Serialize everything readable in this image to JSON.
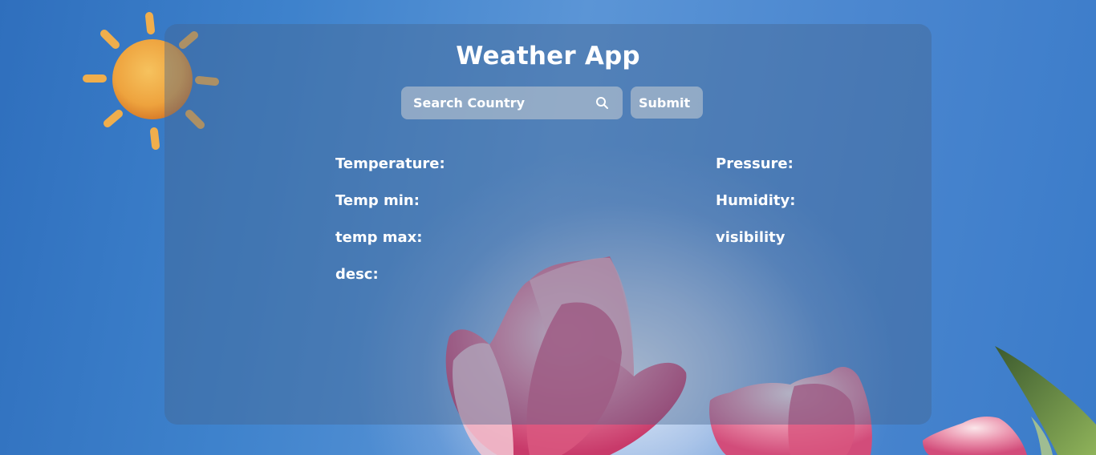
{
  "app": {
    "title": "Weather App"
  },
  "search": {
    "placeholder": "Search Country",
    "value": "",
    "icon": "search-icon"
  },
  "submit": {
    "label": "Submit"
  },
  "weather": {
    "left": [
      {
        "label": "Temperature:"
      },
      {
        "label": "Temp min:"
      },
      {
        "label": "temp max:"
      },
      {
        "label": "desc:"
      }
    ],
    "right": [
      {
        "label": "Pressure:"
      },
      {
        "label": "Humidity:"
      },
      {
        "label": "visibility"
      }
    ]
  },
  "decor": {
    "sun_icon": "sun-icon",
    "background": "tulips-photo"
  },
  "colors": {
    "sky": "#3e82cc",
    "card": "#46648c",
    "sun": "#f0a640",
    "tulip": "#e0608a",
    "text": "#ffffff"
  }
}
